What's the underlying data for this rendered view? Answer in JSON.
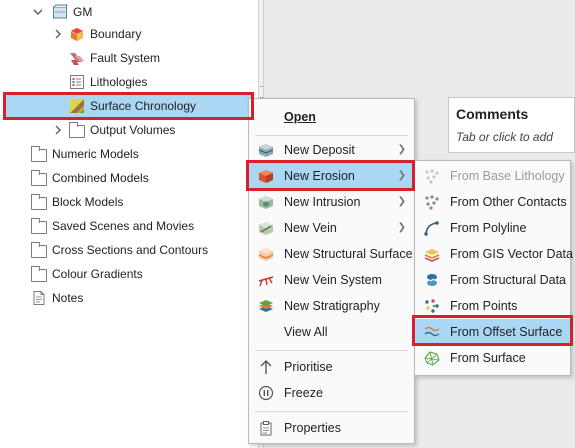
{
  "tree": {
    "gm_label": "GM",
    "boundary_label": "Boundary",
    "fault_system_label": "Fault System",
    "lithologies_label": "Lithologies",
    "surface_chronology_label": "Surface Chronology",
    "output_volumes_label": "Output Volumes",
    "folders": [
      "Numeric Models",
      "Combined Models",
      "Block Models",
      "Saved Scenes and Movies",
      "Cross Sections and Contours",
      "Colour Gradients"
    ],
    "notes_label": "Notes"
  },
  "comments": {
    "title": "Comments",
    "placeholder": "Tab or click to add"
  },
  "context_menu": {
    "open": "Open",
    "new_deposit": "New Deposit",
    "new_erosion": "New Erosion",
    "new_intrusion": "New Intrusion",
    "new_vein": "New Vein",
    "new_structural_surface": "New Structural Surface",
    "new_vein_system": "New Vein System",
    "new_stratigraphy": "New Stratigraphy",
    "view_all": "View All",
    "prioritise": "Prioritise",
    "freeze": "Freeze",
    "properties": "Properties"
  },
  "submenu": {
    "from_base_lithology": "From Base Lithology",
    "from_other_contacts": "From Other Contacts",
    "from_polyline": "From Polyline",
    "from_gis_vector_data": "From GIS Vector Data",
    "from_structural_data": "From Structural Data",
    "from_points": "From Points",
    "from_offset_surface": "From Offset Surface",
    "from_surface": "From Surface"
  },
  "colors": {
    "selection": "#a9d7f4",
    "highlight_box": "#d6202c"
  },
  "icons": [
    "chevron-down-icon",
    "chevron-right-icon",
    "geological-model-icon",
    "boundary-icon",
    "fault-system-icon",
    "lithologies-icon",
    "surface-chronology-icon",
    "folder-icon",
    "notes-icon",
    "submenu-arrow-icon"
  ]
}
